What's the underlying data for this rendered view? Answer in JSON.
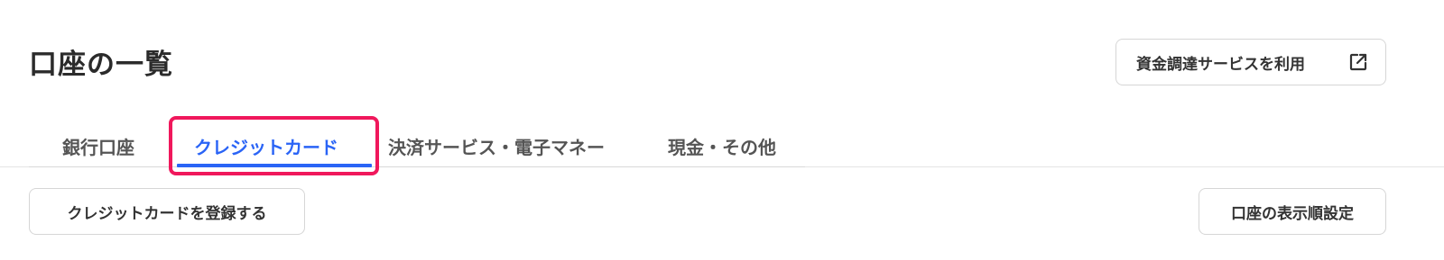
{
  "header": {
    "title": "口座の一覧",
    "funding_button_label": "資金調達サービスを利用",
    "funding_button_icon": "external-link-icon"
  },
  "tabs": [
    {
      "label": "銀行口座",
      "active": false
    },
    {
      "label": "クレジットカード",
      "active": true
    },
    {
      "label": "決済サービス・電子マネー",
      "active": false
    },
    {
      "label": "現金・その他",
      "active": false
    }
  ],
  "actions": {
    "register_card_label": "クレジットカードを登録する",
    "display_order_label": "口座の表示順設定"
  },
  "colors": {
    "accent": "#2a64f6",
    "highlight": "#f0185c",
    "text": "#2b2b2b"
  }
}
